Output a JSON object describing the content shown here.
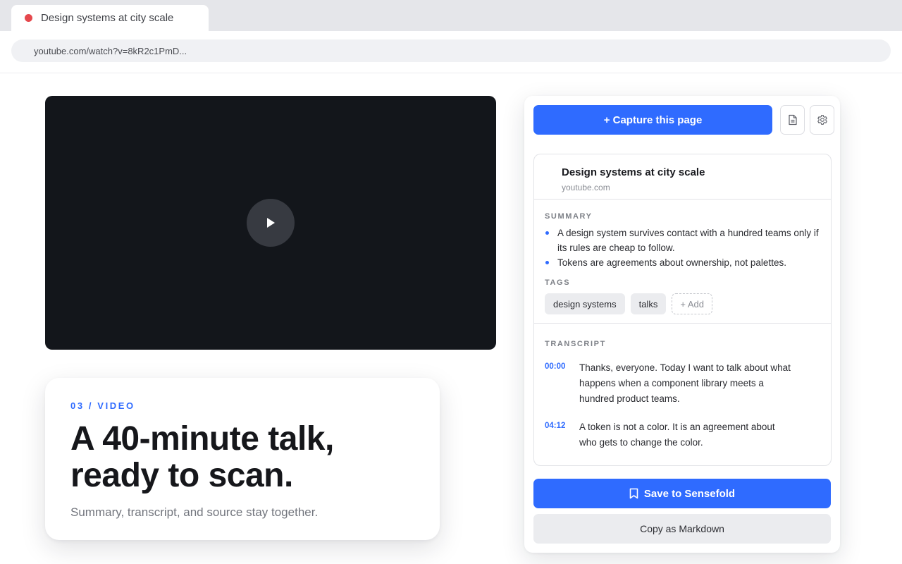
{
  "browser": {
    "tab": {
      "title": "Design systems at city scale",
      "status_color": "#e5484d",
      "icon": "recording-dot-icon"
    },
    "url": "youtube.com/watch?v=8kR2c1PmD..."
  },
  "video": {
    "play_icon": "play-icon"
  },
  "hero": {
    "eyebrow": "03 / VIDEO",
    "headline_line1": "A 40-minute talk,",
    "headline_line2": "ready to scan.",
    "subtext": "Summary, transcript, and source stay together."
  },
  "panel": {
    "capture_label": "+ Capture this page",
    "doc_icon": "document-icon",
    "settings_icon": "gear-icon",
    "source": {
      "title": "Design systems at city scale",
      "domain": "youtube.com"
    },
    "summary_label": "SUMMARY",
    "summary": [
      "A design system survives contact with a hundred teams only if its rules are cheap to follow.",
      "Tokens are agreements about ownership, not palettes."
    ],
    "tags_label": "TAGS",
    "tags": [
      "design systems",
      "talks"
    ],
    "add_tag_label": "+ Add",
    "transcript_label": "TRANSCRIPT",
    "transcript": [
      {
        "time": "00:00",
        "text": "Thanks, everyone. Today I want to talk about what happens when a component library meets a hundred product teams."
      },
      {
        "time": "04:12",
        "text": "A token is not a color. It is an agreement about who gets to change the color."
      }
    ],
    "save_label": "Save to Sensefold",
    "save_icon": "bookmark-icon",
    "copy_label": "Copy as Markdown"
  },
  "colors": {
    "accent": "#2f6bff",
    "video_bg": "#13161b"
  }
}
